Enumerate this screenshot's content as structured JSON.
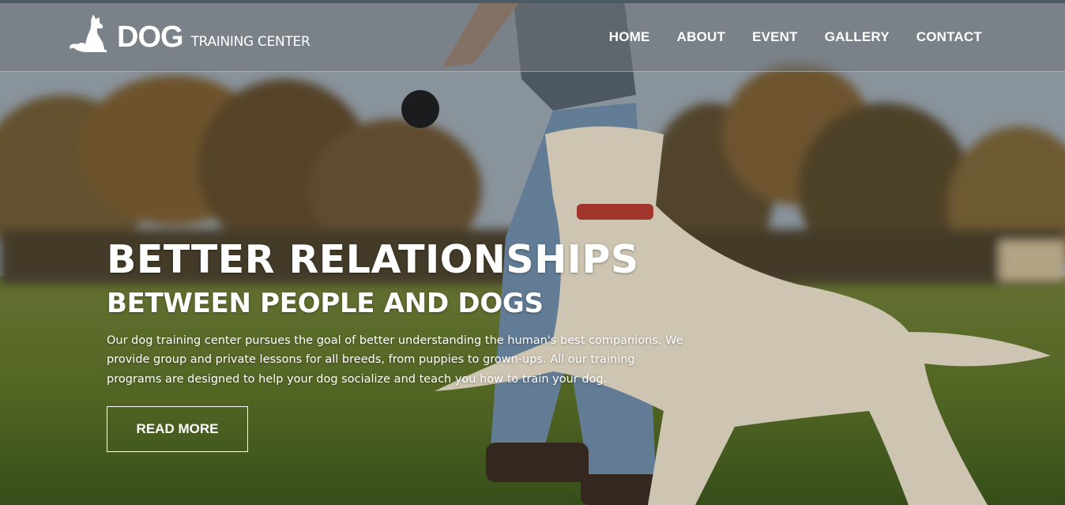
{
  "brand": {
    "name": "DOG",
    "tagline": "TRAINING CENTER",
    "logo_icon": "sitting-dog-icon"
  },
  "nav": {
    "items": [
      {
        "label": "HOME"
      },
      {
        "label": "ABOUT"
      },
      {
        "label": "EVENT"
      },
      {
        "label": "GALLERY"
      },
      {
        "label": "CONTACT"
      }
    ]
  },
  "hero": {
    "title": "BETTER RELATIONSHIPS",
    "subtitle": "BETWEEN PEOPLE AND DOGS",
    "description": "Our dog training center pursues the goal of better understanding the human's best companions. We provide group and private lessons for all breeds, from puppies to grown-ups. All our training programs are designed to help your dog socialize and teach you how to train your dog.",
    "cta_label": "READ MORE",
    "background_image": "man-playing-with-white-dog-in-park"
  },
  "colors": {
    "nav_overlay": "#6e7378",
    "text": "#ffffff",
    "topline": "#4c5a66"
  }
}
